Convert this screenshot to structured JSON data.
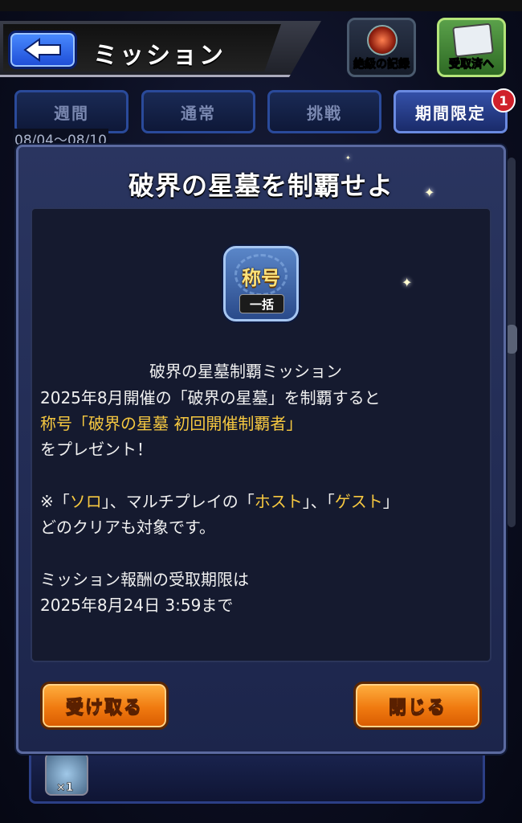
{
  "header": {
    "title": "ミッション",
    "records_label": "絶級の記録",
    "received_label": "受取済へ"
  },
  "tabs": [
    {
      "label": "週間",
      "active": false
    },
    {
      "label": "通常",
      "active": false
    },
    {
      "label": "挑戦",
      "active": false
    },
    {
      "label": "期間限定",
      "active": true
    }
  ],
  "tab_badge": "1",
  "date_range": "08/04〜08/10",
  "dialog": {
    "title": "破界の星墓を制覇せよ",
    "reward": {
      "title": "称号",
      "sub": "一括"
    },
    "lines": {
      "l1": "破界の星墓制覇ミッション",
      "l2": "2025年8月開催の「破界の星墓」を制覇すると",
      "l3": "称号「破界の星墓 初回開催制覇者」",
      "l4": "をプレゼント！",
      "l5_a": "※「",
      "l5_b": "ソロ",
      "l5_c": "」、マルチプレイの「",
      "l5_d": "ホスト",
      "l5_e": "」、「",
      "l5_f": "ゲスト",
      "l5_g": "」",
      "l6": "どのクリアも対象です。",
      "l7": "ミッション報酬の受取期限は",
      "l8": "2025年8月24日 3:59まで"
    },
    "receive_button": "受け取る",
    "close_button": "閉じる"
  },
  "list_item": {
    "multiplier": "×1"
  },
  "colors": {
    "highlight": "#f6c840",
    "button_orange": "#f07a10",
    "tab_active": "#3450a8"
  }
}
